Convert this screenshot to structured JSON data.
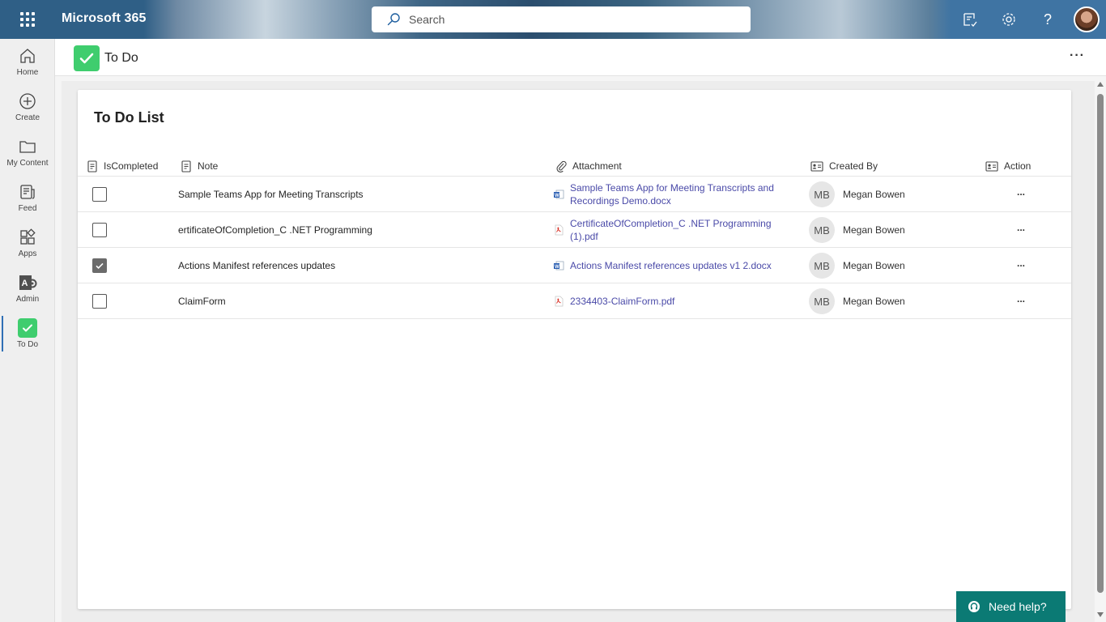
{
  "topbar": {
    "brand": "Microsoft 365",
    "search_placeholder": "Search",
    "icons": [
      "waffle-icon",
      "search-icon",
      "feedback-icon",
      "settings-icon",
      "help-icon",
      "profile-avatar"
    ]
  },
  "rail": {
    "items": [
      {
        "label": "Home",
        "icon": "home-icon"
      },
      {
        "label": "Create",
        "icon": "create-plus-icon"
      },
      {
        "label": "My Content",
        "icon": "folder-icon"
      },
      {
        "label": "Feed",
        "icon": "feed-icon"
      },
      {
        "label": "Apps",
        "icon": "apps-icon"
      },
      {
        "label": "Admin",
        "icon": "admin-icon"
      },
      {
        "label": "To Do",
        "icon": "todo-icon",
        "active": true
      }
    ]
  },
  "app": {
    "title": "To Do",
    "more_label": "···"
  },
  "list": {
    "title": "To Do List",
    "columns": {
      "is_completed": "IsCompleted",
      "note": "Note",
      "attachment": "Attachment",
      "created_by": "Created By",
      "action": "Action"
    },
    "rows": [
      {
        "completed": false,
        "note": "Sample Teams App for Meeting Transcripts",
        "attachment": "Sample Teams App for Meeting Transcripts and Recordings Demo.docx",
        "file_type": "word",
        "initials": "MB",
        "created_by": "Megan Bowen",
        "action": "..."
      },
      {
        "completed": false,
        "note": "ertificateOfCompletion_C .NET Programming",
        "attachment": "CertificateOfCompletion_C .NET Programming (1).pdf",
        "file_type": "pdf",
        "initials": "MB",
        "created_by": "Megan Bowen",
        "action": "..."
      },
      {
        "completed": true,
        "note": "Actions Manifest references updates",
        "attachment": "Actions Manifest references updates v1 2.docx",
        "file_type": "word",
        "initials": "MB",
        "created_by": "Megan Bowen",
        "action": "..."
      },
      {
        "completed": false,
        "note": "ClaimForm",
        "attachment": "2334403-ClaimForm.pdf",
        "file_type": "pdf",
        "initials": "MB",
        "created_by": "Megan Bowen",
        "action": "..."
      }
    ]
  },
  "help": {
    "label": "Need help?"
  },
  "colors": {
    "accent": "#3fcd6e",
    "link": "#4a4aa8",
    "help_bg": "#0b7a74",
    "topbar_right": "#3f74a3"
  }
}
